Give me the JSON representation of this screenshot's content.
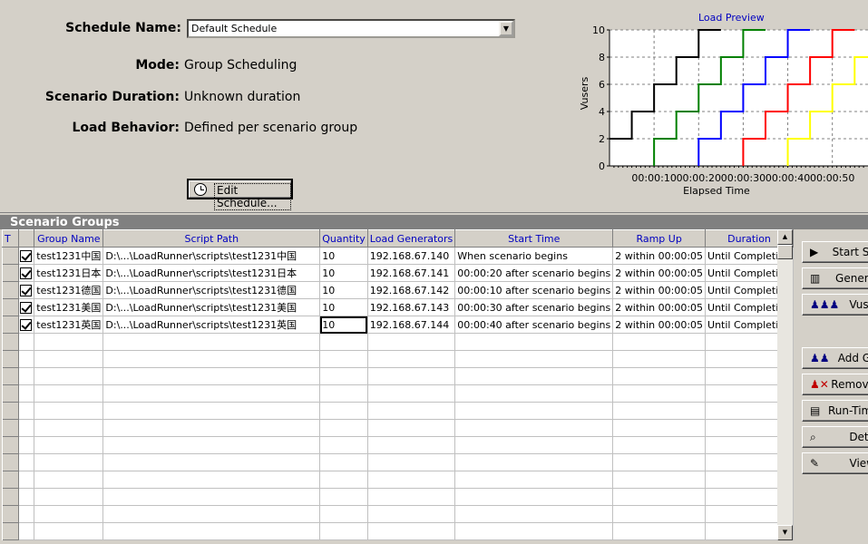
{
  "schedule": {
    "name_label": "Schedule Name:",
    "name_value": "Default Schedule",
    "mode_label": "Mode:",
    "mode_value": "Group Scheduling",
    "duration_label": "Scenario Duration:",
    "duration_value": "Unknown duration",
    "behavior_label": "Load Behavior:",
    "behavior_value": "Defined per scenario group",
    "edit_button": "Edit Schedule..."
  },
  "chart_data": {
    "type": "line",
    "title": "Load Preview",
    "xlabel": "Elapsed Time",
    "ylabel": "Vusers",
    "x_ticks": [
      "00:00:10",
      "00:00:20",
      "00:00:30",
      "00:00:40",
      "00:00:50"
    ],
    "y_ticks": [
      "0",
      "2",
      "4",
      "6",
      "8",
      "10"
    ],
    "ylim": [
      0,
      10
    ],
    "xlim_seconds": [
      0,
      58
    ],
    "grid": true,
    "series": [
      {
        "color": "#000000",
        "x_seconds": [
          0,
          5,
          5,
          10,
          10,
          15,
          15,
          20,
          20,
          25
        ],
        "values": [
          2,
          2,
          4,
          4,
          6,
          6,
          8,
          8,
          10,
          10
        ]
      },
      {
        "color": "#008000",
        "x_seconds": [
          10,
          10,
          15,
          15,
          20,
          20,
          25,
          25,
          30,
          30,
          35
        ],
        "values": [
          0,
          2,
          2,
          4,
          4,
          6,
          6,
          8,
          8,
          10,
          10
        ]
      },
      {
        "color": "#0000ff",
        "x_seconds": [
          20,
          20,
          25,
          25,
          30,
          30,
          35,
          35,
          40,
          40,
          45
        ],
        "values": [
          0,
          2,
          2,
          4,
          4,
          6,
          6,
          8,
          8,
          10,
          10
        ]
      },
      {
        "color": "#ff0000",
        "x_seconds": [
          30,
          30,
          35,
          35,
          40,
          40,
          45,
          45,
          50,
          50,
          55
        ],
        "values": [
          0,
          2,
          2,
          4,
          4,
          6,
          6,
          8,
          8,
          10,
          10
        ]
      },
      {
        "color": "#ffff00",
        "x_seconds": [
          40,
          40,
          45,
          45,
          50,
          50,
          55,
          55,
          58
        ],
        "values": [
          0,
          2,
          2,
          4,
          4,
          6,
          6,
          8,
          8
        ]
      }
    ]
  },
  "groups": {
    "title": "Scenario Groups",
    "columns": [
      "T",
      "",
      "Group Name",
      "Script Path",
      "Quantity",
      "Load Generators",
      "Start Time",
      "Ramp Up",
      "Duration"
    ],
    "rows": [
      [
        "test1231中国",
        "D:\\...\\LoadRunner\\scripts\\test1231中国",
        "10",
        "192.168.67.140",
        "When scenario begins",
        "2 within 00:00:05",
        "Until Completion"
      ],
      [
        "test1231日本",
        "D:\\...\\LoadRunner\\scripts\\test1231日本",
        "10",
        "192.168.67.141",
        "00:00:20 after scenario begins",
        "2 within 00:00:05",
        "Until Completion"
      ],
      [
        "test1231德国",
        "D:\\...\\LoadRunner\\scripts\\test1231德国",
        "10",
        "192.168.67.142",
        "00:00:10 after scenario begins",
        "2 within 00:00:05",
        "Until Completion"
      ],
      [
        "test1231美国",
        "D:\\...\\LoadRunner\\scripts\\test1231美国",
        "10",
        "192.168.67.143",
        "00:00:30 after scenario begins",
        "2 within 00:00:05",
        "Until Completion"
      ],
      [
        "test1231英国",
        "D:\\...\\LoadRunner\\scripts\\test1231英国",
        "10",
        "192.168.67.144",
        "00:00:40 after scenario begins",
        "2 within 00:00:05",
        "Until Completion"
      ]
    ]
  },
  "side_buttons": [
    {
      "label": "Start Sc",
      "icon": "play-icon",
      "glyph": "▶"
    },
    {
      "label": "Genera",
      "icon": "generator-icon",
      "glyph": "▥"
    },
    {
      "label": "Vuse",
      "icon": "vusers-icon",
      "glyph": "♟♟♟"
    },
    {
      "label": "Add Gr",
      "icon": "add-group-icon",
      "glyph": "♟♟"
    },
    {
      "label": "Remove",
      "icon": "remove-group-icon",
      "glyph": "♟✕"
    },
    {
      "label": "Run-Time",
      "icon": "runtime-settings-icon",
      "glyph": "▤"
    },
    {
      "label": "Deta",
      "icon": "details-icon",
      "glyph": "⌕"
    },
    {
      "label": "View",
      "icon": "view-script-icon",
      "glyph": "✎"
    }
  ]
}
